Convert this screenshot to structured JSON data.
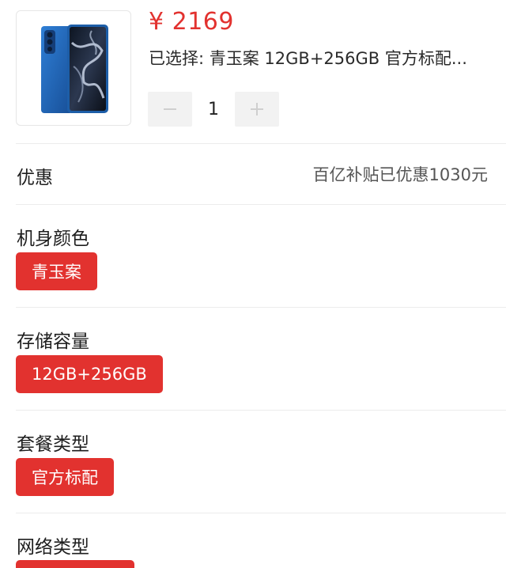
{
  "product": {
    "price": "¥ 2169",
    "selected": "已选择: 青玉案 12GB+256GB 官方标配...",
    "quantity": "1",
    "image_icon": "phone-icon"
  },
  "discount": {
    "label": "优惠",
    "value": "百亿补贴已优惠1030元"
  },
  "options": {
    "color": {
      "label": "机身颜色",
      "selected": "青玉案"
    },
    "storage": {
      "label": "存储容量",
      "selected": "12GB+256GB"
    },
    "package": {
      "label": "套餐类型",
      "selected": "官方标配"
    },
    "network": {
      "label": "网络类型"
    }
  },
  "colors": {
    "accent": "#e2322f",
    "stepper_bg": "#f2f2f2",
    "phone_blue": "#1f63b5"
  }
}
